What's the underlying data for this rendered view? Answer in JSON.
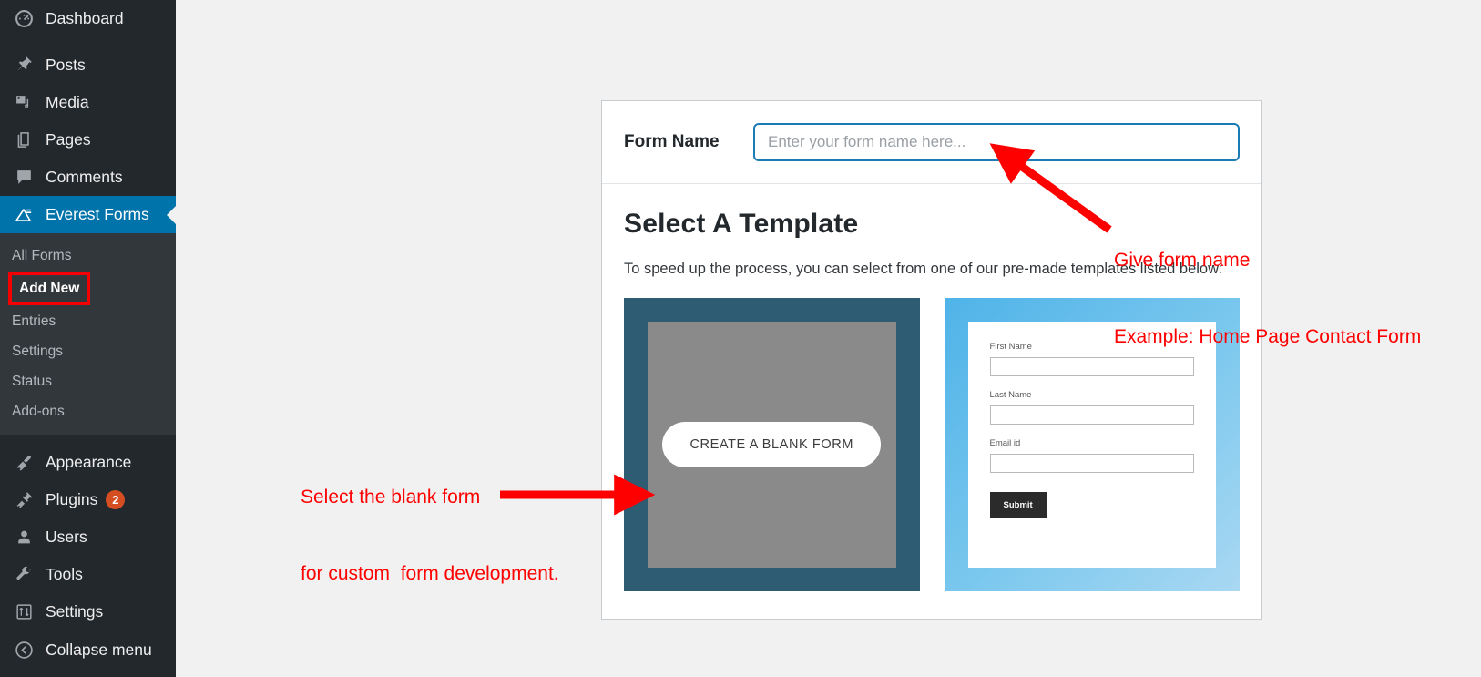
{
  "sidebar": {
    "items": [
      {
        "label": "Dashboard",
        "icon": "dashboard-icon",
        "active": false
      },
      {
        "label": "Posts",
        "icon": "pin-icon",
        "active": false
      },
      {
        "label": "Media",
        "icon": "media-icon",
        "active": false
      },
      {
        "label": "Pages",
        "icon": "pages-icon",
        "active": false
      },
      {
        "label": "Comments",
        "icon": "comments-icon",
        "active": false
      },
      {
        "label": "Everest Forms",
        "icon": "everest-forms-icon",
        "active": true
      }
    ],
    "submenu": [
      {
        "label": "All Forms",
        "current": false,
        "highlighted": false
      },
      {
        "label": "Add New",
        "current": true,
        "highlighted": true
      },
      {
        "label": "Entries",
        "current": false,
        "highlighted": false
      },
      {
        "label": "Settings",
        "current": false,
        "highlighted": false
      },
      {
        "label": "Status",
        "current": false,
        "highlighted": false
      },
      {
        "label": "Add-ons",
        "current": false,
        "highlighted": false
      }
    ],
    "items_bottom": [
      {
        "label": "Appearance",
        "icon": "brush-icon",
        "badge": ""
      },
      {
        "label": "Plugins",
        "icon": "plug-icon",
        "badge": "2"
      },
      {
        "label": "Users",
        "icon": "user-icon",
        "badge": ""
      },
      {
        "label": "Tools",
        "icon": "wrench-icon",
        "badge": ""
      },
      {
        "label": "Settings",
        "icon": "sliders-icon",
        "badge": ""
      }
    ],
    "partial_item": {
      "label": "Collapse menu",
      "icon": "collapse-icon"
    },
    "colors": {
      "background": "#23282d",
      "submenu_background": "#32373c",
      "active": "#0073aa",
      "badge": "#d54e21"
    }
  },
  "form_header": {
    "label": "Form Name",
    "input_value": "",
    "placeholder": "Enter your form name here...",
    "focus_color": "#1b7bb5"
  },
  "template_section": {
    "heading": "Select A Template",
    "subtext": "To speed up the process, you can select from one of our pre-made templates listed below:",
    "templates": [
      {
        "name": "blank-form",
        "button_label": "CREATE A BLANK FORM",
        "accent": "#2e5c73"
      },
      {
        "name": "contact-form",
        "accent": "#4fb3e8",
        "fields": [
          {
            "label": "First Name"
          },
          {
            "label": "Last Name"
          },
          {
            "label": "Email id"
          }
        ],
        "submit_label": "Submit"
      }
    ]
  },
  "annotations": {
    "color": "#ff0000",
    "form_name": {
      "line1": "Give form name",
      "line2": "Example: Home Page Contact Form"
    },
    "blank_form": {
      "line1": "Select the blank form",
      "line2": "for custom  form development."
    }
  }
}
